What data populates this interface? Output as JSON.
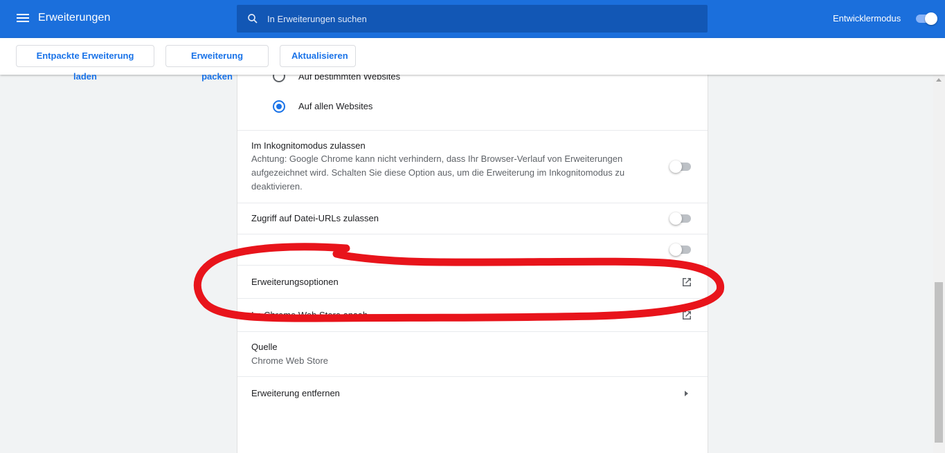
{
  "header": {
    "title": "Erweiterungen",
    "search_placeholder": "In Erweiterungen suchen",
    "devmode_label": "Entwicklermodus",
    "devmode_on": true,
    "accent": "#1b6fdc"
  },
  "toolbar": {
    "load_unpacked": "Entpackte Erweiterung laden",
    "pack": "Erweiterung packen",
    "update": "Aktualisieren"
  },
  "details": {
    "site_access_options": [
      {
        "label": "Auf bestimmten Websites",
        "checked": false
      },
      {
        "label": "Auf allen Websites",
        "checked": true
      }
    ],
    "incognito": {
      "label": "Im Inkognitomodus zulassen",
      "description": "Achtung: Google Chrome kann nicht verhindern, dass Ihr Browser-Verlauf von Erweiterungen aufgezeichnet wird. Schalten Sie diese Option aus, um die Erweiterung im Inkognitomodus zu deaktivieren.",
      "enabled": false
    },
    "file_urls": {
      "label": "Zugriff auf Datei-URLs zulassen",
      "enabled": false
    },
    "hidden_toggle_row": {
      "enabled": false
    },
    "options_link": "Erweiterungsoptionen",
    "webstore_link": "Im Chrome Web Store anseh",
    "source": {
      "label": "Quelle",
      "value": "Chrome Web Store"
    },
    "remove": "Erweiterung entfernen"
  },
  "annotation": {
    "color": "#e8141b"
  }
}
